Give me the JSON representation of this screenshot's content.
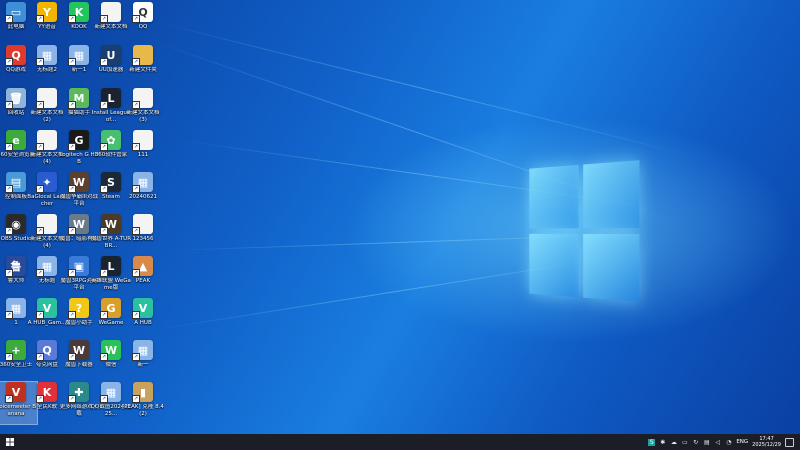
{
  "desktop": {
    "icons": [
      {
        "label": "此电脑",
        "color": "#3e8fd8",
        "char": "▭"
      },
      {
        "label": "YY语音",
        "color": "#f2b600",
        "char": "Y"
      },
      {
        "label": "KOOK",
        "color": "#23c55e",
        "char": "K"
      },
      {
        "label": "新建文本文档",
        "color": "#f4f4f4",
        "char": ""
      },
      {
        "label": "QQ",
        "color": "#ffffff",
        "char": "Q"
      },
      {
        "label": "QQ游戏",
        "color": "#e03a2e",
        "char": "Q"
      },
      {
        "label": "无标题2",
        "color": "#8ab4e8",
        "char": "▦"
      },
      {
        "label": "新一1",
        "color": "#8ab4e8",
        "char": "▦"
      },
      {
        "label": "UU加速器",
        "color": "#1a3e6e",
        "char": "U"
      },
      {
        "label": "新建文件夹",
        "color": "#e8b84a",
        "char": ""
      },
      {
        "label": "回收站",
        "color": "#8fb4d8",
        "char": "🗑"
      },
      {
        "label": "新建文本文档 (2)",
        "color": "#f4f4f4",
        "char": ""
      },
      {
        "label": "猫猫助手",
        "color": "#5bb85d",
        "char": "M"
      },
      {
        "label": "Install League of...",
        "color": "#1a2430",
        "char": "L"
      },
      {
        "label": "新建文本文档 (3)",
        "color": "#f4f4f4",
        "char": ""
      },
      {
        "label": "360安全浏览器",
        "color": "#3caa3c",
        "char": "e"
      },
      {
        "label": "新建文本文档 (4)",
        "color": "#f4f4f4",
        "char": ""
      },
      {
        "label": "Logitech G HUB",
        "color": "#1a1a1a",
        "char": "G"
      },
      {
        "label": "360软件管家",
        "color": "#46c06e",
        "char": "✿"
      },
      {
        "label": "111",
        "color": "#f4f4f4",
        "char": ""
      },
      {
        "label": "控制面板",
        "color": "#4a9ad8",
        "char": "▤"
      },
      {
        "label": "BaGlocal Launcher",
        "color": "#2a5bd0",
        "char": "✦"
      },
      {
        "label": "魔兽争霸III对战平台",
        "color": "#5a4030",
        "char": "W"
      },
      {
        "label": "Steam",
        "color": "#1b2838",
        "char": "S"
      },
      {
        "label": "20240621",
        "color": "#8ab4e8",
        "char": "▦"
      },
      {
        "label": "OBS Studio",
        "color": "#2a2a2a",
        "char": "◉"
      },
      {
        "label": "新建文本文档 (4)",
        "color": "#f4f4f4",
        "char": ""
      },
      {
        "label": "魔兽：暗影神殿",
        "color": "#6a7a8a",
        "char": "W"
      },
      {
        "label": "魔兽世界 A-TURBR...",
        "color": "#4a3a2a",
        "char": "W"
      },
      {
        "label": "123456",
        "color": "#f4f4f4",
        "char": ""
      },
      {
        "label": "鲁大师",
        "color": "#2a4a9a",
        "char": "鲁"
      },
      {
        "label": "无标题",
        "color": "#8ab4e8",
        "char": "▦"
      },
      {
        "label": "魔兽3RPG对战平台",
        "color": "#3a7ad8",
        "char": "▣"
      },
      {
        "label": "英雄联盟 WeGame版",
        "color": "#1a2430",
        "char": "L"
      },
      {
        "label": "PEAK",
        "color": "#d88a4a",
        "char": "▲"
      },
      {
        "label": "1",
        "color": "#8ab4e8",
        "char": "▦"
      },
      {
        "label": "A HUB_Gam...",
        "color": "#2ac0a0",
        "char": "V"
      },
      {
        "label": "魔兽小助手",
        "color": "#f2c818",
        "char": "?"
      },
      {
        "label": "WeGame",
        "color": "#d8a02a",
        "char": "G"
      },
      {
        "label": "A HUB",
        "color": "#2ac0a0",
        "char": "V"
      },
      {
        "label": "360安全卫士",
        "color": "#3caa3c",
        "char": "+"
      },
      {
        "label": "夸克网盘",
        "color": "#5a7ad8",
        "char": "Q"
      },
      {
        "label": "魔兽下载器",
        "color": "#4a3a3a",
        "char": "W"
      },
      {
        "label": "微信",
        "color": "#2ac15a",
        "char": "W"
      },
      {
        "label": "新一",
        "color": "#8ab4e8",
        "char": "▦"
      },
      {
        "label": "Voicemeeter Banana",
        "color": "#c03020",
        "char": "V"
      },
      {
        "label": "全民K歌",
        "color": "#e0303a",
        "char": "K"
      },
      {
        "label": "更多网络游戏下载",
        "color": "#2a8a8a",
        "char": "✚"
      },
      {
        "label": "QQ截图20241125...",
        "color": "#8ab4e8",
        "char": "▦"
      },
      {
        "label": "[PEAK] 克隆 8.4 (2)",
        "color": "#c8a060",
        "char": "▮"
      }
    ]
  },
  "taskbar": {
    "tray_lang": "ENG",
    "time": "17:47",
    "date": "2025/12/29"
  }
}
